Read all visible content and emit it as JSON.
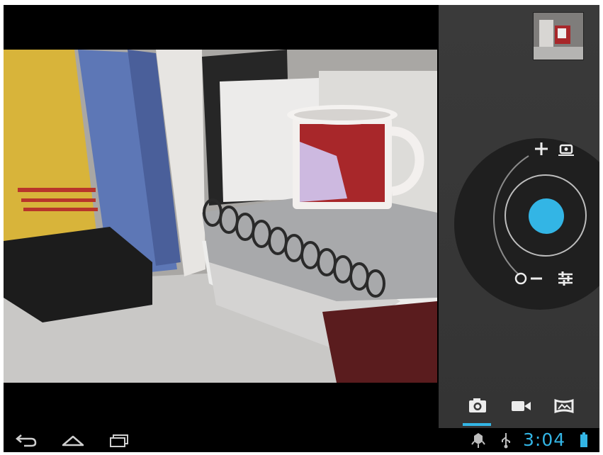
{
  "status_bar": {
    "time": "3:04"
  },
  "camera": {
    "mode_selected": "photo",
    "modes": [
      "camera-mode",
      "video-mode",
      "panorama-mode"
    ]
  },
  "icons": {
    "zoom_in": "plus-icon",
    "zoom_out": "minus-icon",
    "switch_camera": "switch-camera-icon",
    "settings": "settings-sliders-icon",
    "back": "back-icon",
    "home": "home-icon",
    "recents": "recent-apps-icon",
    "usb": "usb-icon",
    "debug": "android-debug-icon",
    "battery": "battery-icon"
  },
  "colors": {
    "accent": "#33b5e5",
    "panel": "#383838",
    "dial": "#1f1f1f"
  }
}
